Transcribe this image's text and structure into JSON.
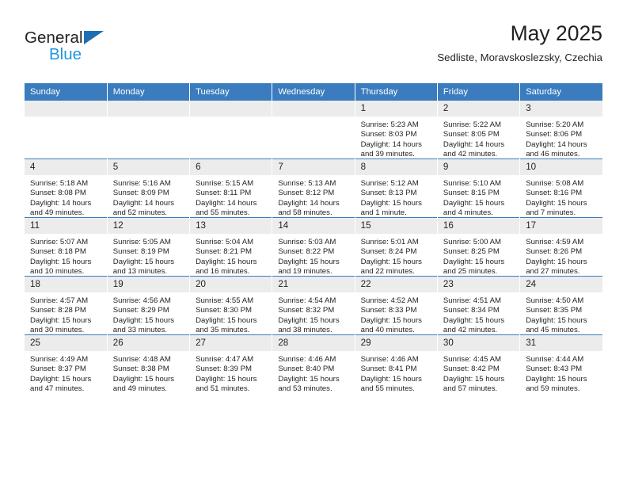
{
  "brand": {
    "name_top": "General",
    "name_bottom": "Blue",
    "accent_blue": "#1c6fb5",
    "light_blue": "#2196e3"
  },
  "header": {
    "title": "May 2025",
    "subtitle": "Sedliste, Moravskoslezsky, Czechia"
  },
  "theme": {
    "header_row_bg": "#3a7cbe",
    "daynum_bg": "#ececec",
    "text": "#231f20"
  },
  "weekdays": [
    "Sunday",
    "Monday",
    "Tuesday",
    "Wednesday",
    "Thursday",
    "Friday",
    "Saturday"
  ],
  "labels": {
    "sunrise_prefix": "Sunrise:",
    "sunset_prefix": "Sunset:",
    "daylight_prefix": "Daylight:"
  },
  "weeks": [
    [
      {
        "day": "",
        "empty": true
      },
      {
        "day": "",
        "empty": true
      },
      {
        "day": "",
        "empty": true
      },
      {
        "day": "",
        "empty": true
      },
      {
        "day": "1",
        "sunrise": "Sunrise: 5:23 AM",
        "sunset": "Sunset: 8:03 PM",
        "daylight": "Daylight: 14 hours and 39 minutes."
      },
      {
        "day": "2",
        "sunrise": "Sunrise: 5:22 AM",
        "sunset": "Sunset: 8:05 PM",
        "daylight": "Daylight: 14 hours and 42 minutes."
      },
      {
        "day": "3",
        "sunrise": "Sunrise: 5:20 AM",
        "sunset": "Sunset: 8:06 PM",
        "daylight": "Daylight: 14 hours and 46 minutes."
      }
    ],
    [
      {
        "day": "4",
        "sunrise": "Sunrise: 5:18 AM",
        "sunset": "Sunset: 8:08 PM",
        "daylight": "Daylight: 14 hours and 49 minutes."
      },
      {
        "day": "5",
        "sunrise": "Sunrise: 5:16 AM",
        "sunset": "Sunset: 8:09 PM",
        "daylight": "Daylight: 14 hours and 52 minutes."
      },
      {
        "day": "6",
        "sunrise": "Sunrise: 5:15 AM",
        "sunset": "Sunset: 8:11 PM",
        "daylight": "Daylight: 14 hours and 55 minutes."
      },
      {
        "day": "7",
        "sunrise": "Sunrise: 5:13 AM",
        "sunset": "Sunset: 8:12 PM",
        "daylight": "Daylight: 14 hours and 58 minutes."
      },
      {
        "day": "8",
        "sunrise": "Sunrise: 5:12 AM",
        "sunset": "Sunset: 8:13 PM",
        "daylight": "Daylight: 15 hours and 1 minute."
      },
      {
        "day": "9",
        "sunrise": "Sunrise: 5:10 AM",
        "sunset": "Sunset: 8:15 PM",
        "daylight": "Daylight: 15 hours and 4 minutes."
      },
      {
        "day": "10",
        "sunrise": "Sunrise: 5:08 AM",
        "sunset": "Sunset: 8:16 PM",
        "daylight": "Daylight: 15 hours and 7 minutes."
      }
    ],
    [
      {
        "day": "11",
        "sunrise": "Sunrise: 5:07 AM",
        "sunset": "Sunset: 8:18 PM",
        "daylight": "Daylight: 15 hours and 10 minutes."
      },
      {
        "day": "12",
        "sunrise": "Sunrise: 5:05 AM",
        "sunset": "Sunset: 8:19 PM",
        "daylight": "Daylight: 15 hours and 13 minutes."
      },
      {
        "day": "13",
        "sunrise": "Sunrise: 5:04 AM",
        "sunset": "Sunset: 8:21 PM",
        "daylight": "Daylight: 15 hours and 16 minutes."
      },
      {
        "day": "14",
        "sunrise": "Sunrise: 5:03 AM",
        "sunset": "Sunset: 8:22 PM",
        "daylight": "Daylight: 15 hours and 19 minutes."
      },
      {
        "day": "15",
        "sunrise": "Sunrise: 5:01 AM",
        "sunset": "Sunset: 8:24 PM",
        "daylight": "Daylight: 15 hours and 22 minutes."
      },
      {
        "day": "16",
        "sunrise": "Sunrise: 5:00 AM",
        "sunset": "Sunset: 8:25 PM",
        "daylight": "Daylight: 15 hours and 25 minutes."
      },
      {
        "day": "17",
        "sunrise": "Sunrise: 4:59 AM",
        "sunset": "Sunset: 8:26 PM",
        "daylight": "Daylight: 15 hours and 27 minutes."
      }
    ],
    [
      {
        "day": "18",
        "sunrise": "Sunrise: 4:57 AM",
        "sunset": "Sunset: 8:28 PM",
        "daylight": "Daylight: 15 hours and 30 minutes."
      },
      {
        "day": "19",
        "sunrise": "Sunrise: 4:56 AM",
        "sunset": "Sunset: 8:29 PM",
        "daylight": "Daylight: 15 hours and 33 minutes."
      },
      {
        "day": "20",
        "sunrise": "Sunrise: 4:55 AM",
        "sunset": "Sunset: 8:30 PM",
        "daylight": "Daylight: 15 hours and 35 minutes."
      },
      {
        "day": "21",
        "sunrise": "Sunrise: 4:54 AM",
        "sunset": "Sunset: 8:32 PM",
        "daylight": "Daylight: 15 hours and 38 minutes."
      },
      {
        "day": "22",
        "sunrise": "Sunrise: 4:52 AM",
        "sunset": "Sunset: 8:33 PM",
        "daylight": "Daylight: 15 hours and 40 minutes."
      },
      {
        "day": "23",
        "sunrise": "Sunrise: 4:51 AM",
        "sunset": "Sunset: 8:34 PM",
        "daylight": "Daylight: 15 hours and 42 minutes."
      },
      {
        "day": "24",
        "sunrise": "Sunrise: 4:50 AM",
        "sunset": "Sunset: 8:35 PM",
        "daylight": "Daylight: 15 hours and 45 minutes."
      }
    ],
    [
      {
        "day": "25",
        "sunrise": "Sunrise: 4:49 AM",
        "sunset": "Sunset: 8:37 PM",
        "daylight": "Daylight: 15 hours and 47 minutes."
      },
      {
        "day": "26",
        "sunrise": "Sunrise: 4:48 AM",
        "sunset": "Sunset: 8:38 PM",
        "daylight": "Daylight: 15 hours and 49 minutes."
      },
      {
        "day": "27",
        "sunrise": "Sunrise: 4:47 AM",
        "sunset": "Sunset: 8:39 PM",
        "daylight": "Daylight: 15 hours and 51 minutes."
      },
      {
        "day": "28",
        "sunrise": "Sunrise: 4:46 AM",
        "sunset": "Sunset: 8:40 PM",
        "daylight": "Daylight: 15 hours and 53 minutes."
      },
      {
        "day": "29",
        "sunrise": "Sunrise: 4:46 AM",
        "sunset": "Sunset: 8:41 PM",
        "daylight": "Daylight: 15 hours and 55 minutes."
      },
      {
        "day": "30",
        "sunrise": "Sunrise: 4:45 AM",
        "sunset": "Sunset: 8:42 PM",
        "daylight": "Daylight: 15 hours and 57 minutes."
      },
      {
        "day": "31",
        "sunrise": "Sunrise: 4:44 AM",
        "sunset": "Sunset: 8:43 PM",
        "daylight": "Daylight: 15 hours and 59 minutes."
      }
    ]
  ]
}
